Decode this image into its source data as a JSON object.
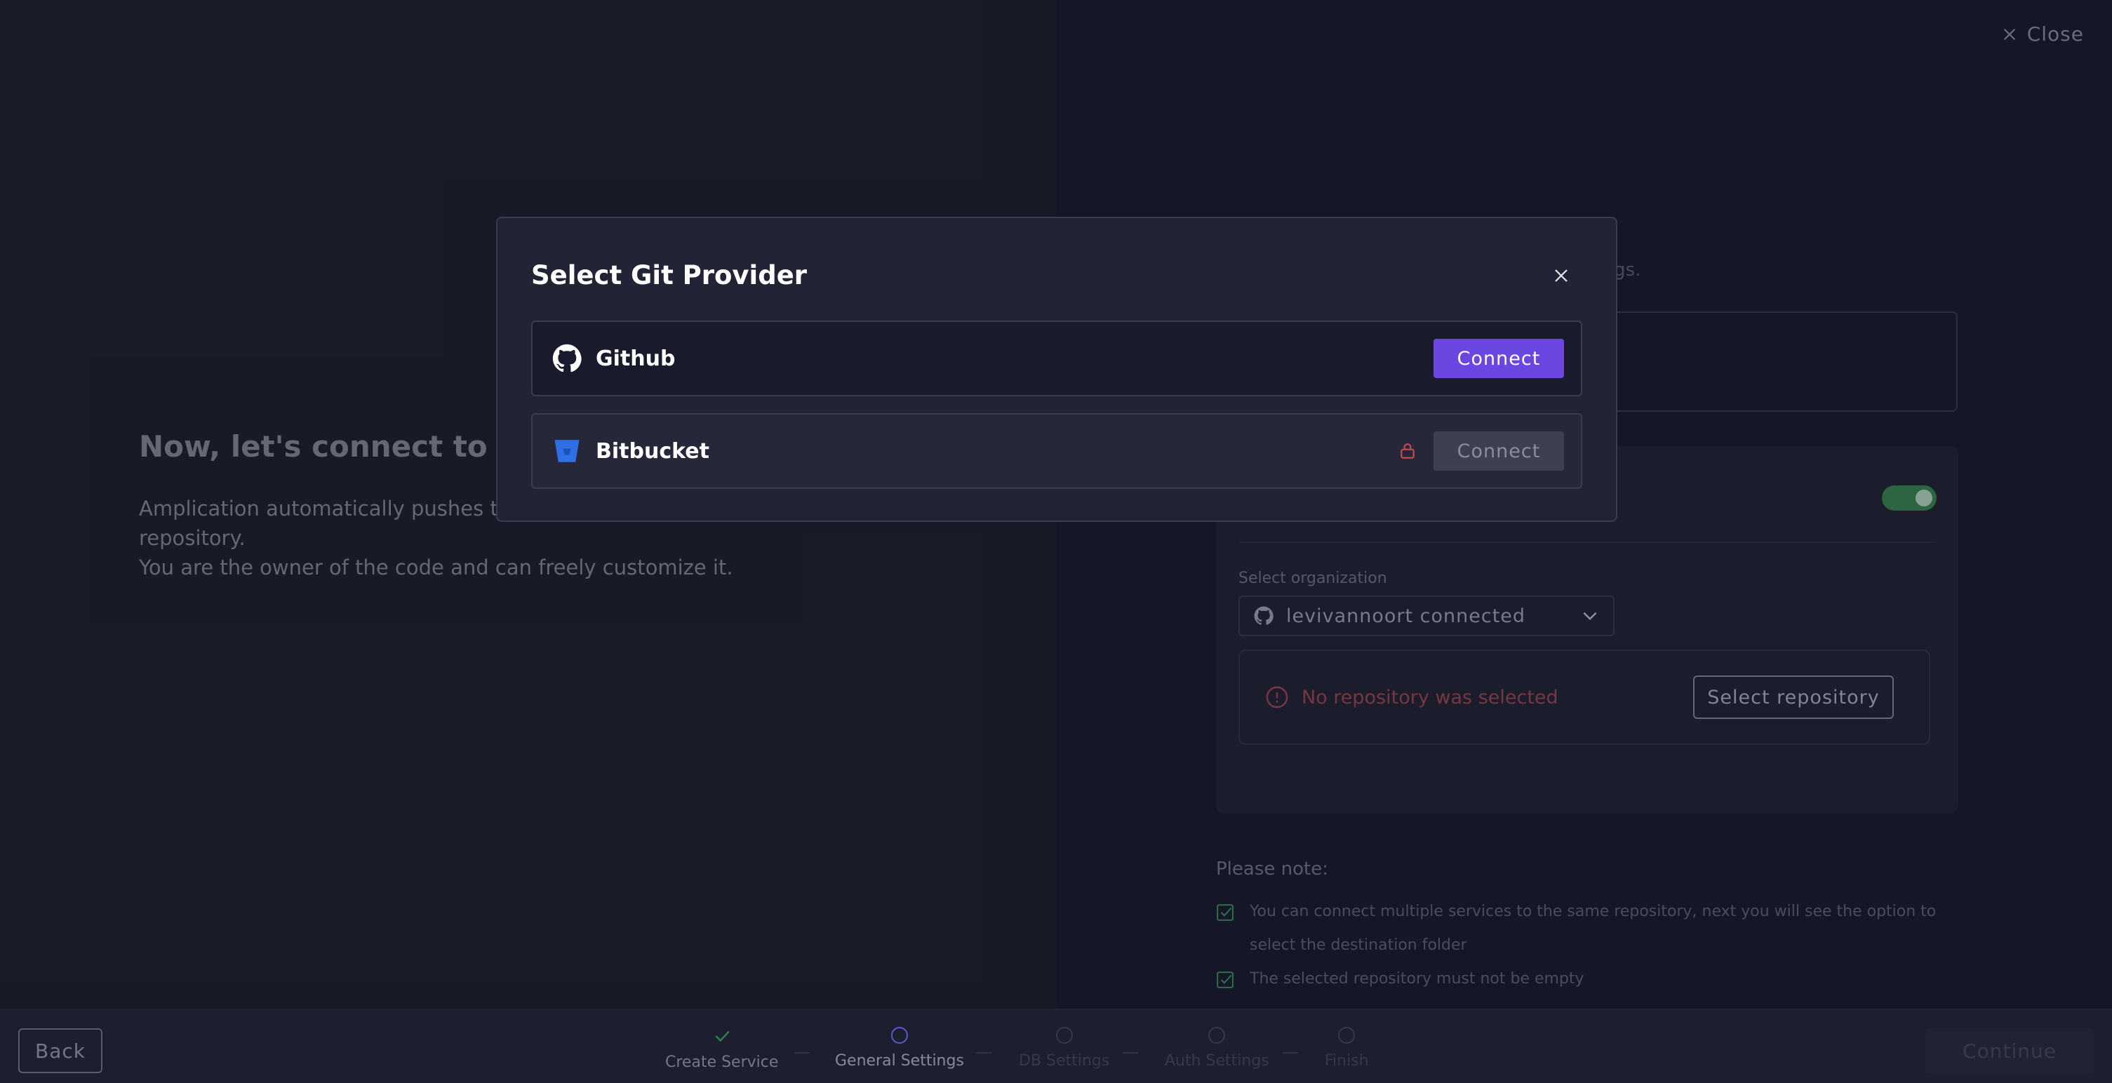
{
  "top": {
    "close_label": "Close"
  },
  "left": {
    "headline": "Now, let's connect to a G",
    "description_lines": [
      "Amplication automatically pushes th",
      "repository.",
      "You are the owner of the code and can freely customize it."
    ]
  },
  "right": {
    "fragment_text": "ttings.",
    "sync_toggle_on": true,
    "organization": {
      "label": "Select organization",
      "value": "levivannoort connected"
    },
    "repository": {
      "warning": "No repository was selected",
      "select_label": "Select repository"
    },
    "notes": {
      "title": "Please note:",
      "items": [
        "You can connect multiple services to the same repository, next you will see the option to select the destination folder",
        "The selected repository must not be empty"
      ]
    }
  },
  "footer": {
    "back_label": "Back",
    "continue_label": "Continue",
    "steps": [
      {
        "label": "Create Service",
        "state": "done"
      },
      {
        "label": "General Settings",
        "state": "current"
      },
      {
        "label": "DB Settings",
        "state": "pending"
      },
      {
        "label": "Auth Settings",
        "state": "pending"
      },
      {
        "label": "Finish",
        "state": "pending"
      }
    ]
  },
  "modal": {
    "title": "Select Git Provider",
    "providers": [
      {
        "name": "Github",
        "connect_label": "Connect",
        "enabled": true,
        "icon": "github-icon"
      },
      {
        "name": "Bitbucket",
        "connect_label": "Connect",
        "enabled": false,
        "locked": true,
        "icon": "bitbucket-icon"
      }
    ]
  },
  "colors": {
    "accent": "#6c46e0",
    "toggle_on": "#2f6a45",
    "warning": "#7a3a44",
    "lock": "#c24a55",
    "bitbucket": "#2f6fe6"
  }
}
